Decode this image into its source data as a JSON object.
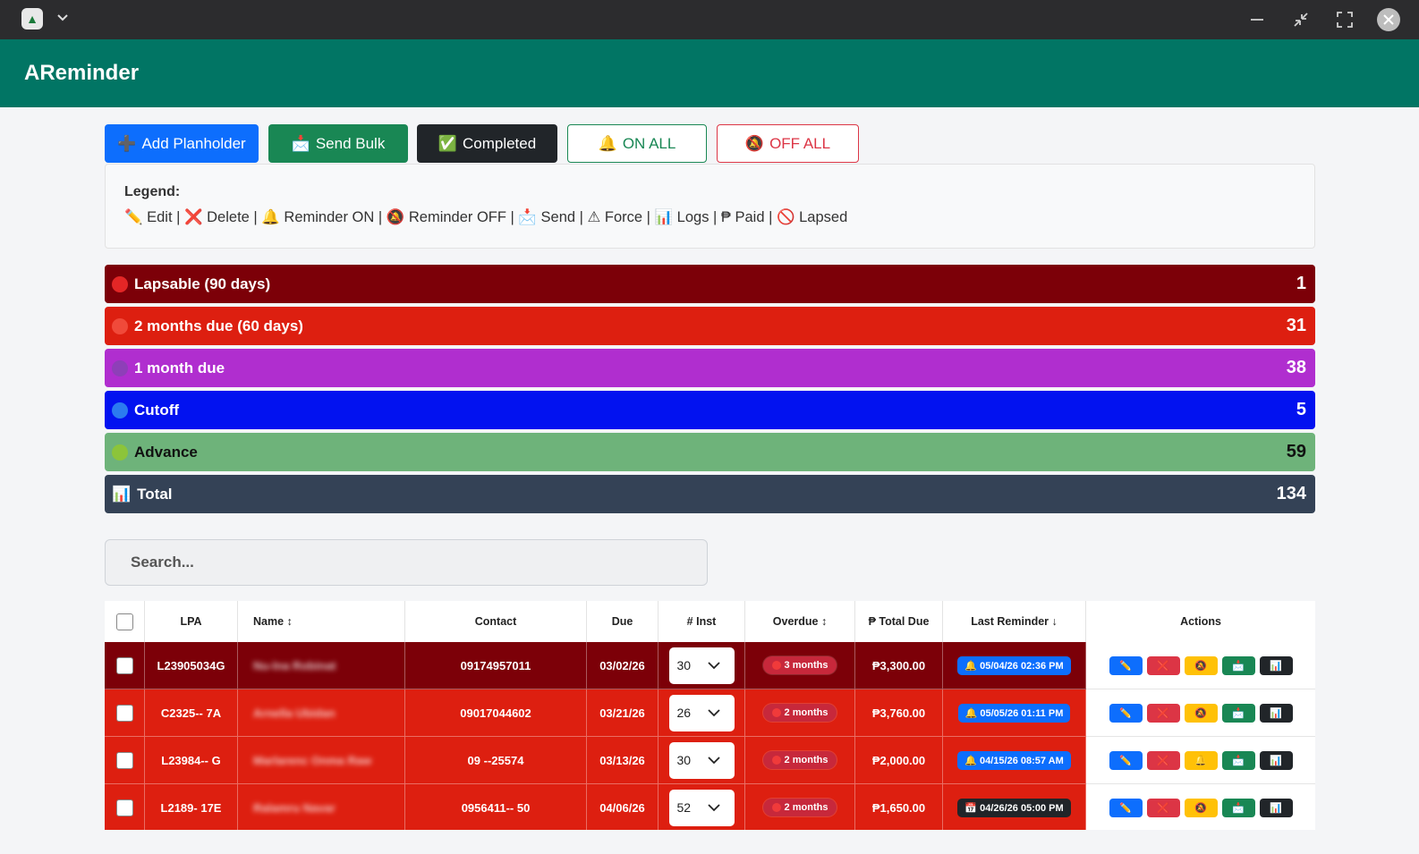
{
  "window": {
    "app_icon": "app-logo-icon"
  },
  "app": {
    "title": "AReminder"
  },
  "toolbar": {
    "add": {
      "icon": "➕",
      "label": "Add Planholder"
    },
    "bulk": {
      "icon": "📩",
      "label": "Send Bulk"
    },
    "completed": {
      "icon": "✅",
      "label": "Completed"
    },
    "on_all": {
      "icon": "🔔",
      "label": "ON ALL"
    },
    "off_all": {
      "icon": "🔕",
      "label": "OFF ALL"
    }
  },
  "legend": {
    "title": "Legend:",
    "text": "✏️ Edit | ❌ Delete | 🔔 Reminder ON | 🔕 Reminder OFF | 📩 Send | ⚠ Force | 📊 Logs | ₱ Paid | 🚫 Lapsed"
  },
  "summary": [
    {
      "label": "Lapsable (90 days)",
      "count": "1",
      "color": "#7c0008",
      "dot": "#e32626"
    },
    {
      "label": "2 months due (60 days)",
      "count": "31",
      "color": "#dd1f10",
      "dot": "#f04a3a"
    },
    {
      "label": "1 month due",
      "count": "38",
      "color": "#b02ecf",
      "dot": "#8e3fb8"
    },
    {
      "label": "Cutoff",
      "count": "5",
      "color": "#0212f0",
      "dot": "#2b7bf0"
    },
    {
      "label": "Advance",
      "count": "59",
      "color": "#6eb37a",
      "dot": "#8cc43a"
    },
    {
      "label": "Total",
      "count": "134",
      "color": "#344256",
      "icon": "📊"
    }
  ],
  "search": {
    "placeholder": "Search..."
  },
  "table": {
    "headers": {
      "lpa": "LPA",
      "name": "Name ↕",
      "contact": "Contact",
      "due": "Due",
      "inst": "# Inst",
      "overdue": "Overdue ↕",
      "total_due": "₱ Total Due",
      "last_reminder": "Last Reminder ↓",
      "actions": "Actions"
    },
    "rows": [
      {
        "lpa": "L23905034G",
        "name": "Nu-lna Robinat",
        "contact": "09174957011",
        "due": "03/02/26",
        "inst": "30",
        "overdue": "3 months",
        "total": "₱3,300.00",
        "reminder": "🔔 05/04/26 02:36 PM",
        "reminder_style": "blue",
        "reminder_action": "🔕",
        "color": "#7c0008"
      },
      {
        "lpa": "C2325-- 7A",
        "name": "Arnella Ubidan",
        "contact": "09017044602",
        "due": "03/21/26",
        "inst": "26",
        "overdue": "2 months",
        "total": "₱3,760.00",
        "reminder": "🔔 05/05/26 01:11 PM",
        "reminder_style": "blue",
        "reminder_action": "🔕",
        "color": "#dd1f10"
      },
      {
        "lpa": "L23984-- G",
        "name": "Marlarenc Onma Raw",
        "contact": "09 --25574",
        "due": "03/13/26",
        "inst": "30",
        "overdue": "2 months",
        "total": "₱2,000.00",
        "reminder": "🔔 04/15/26 08:57 AM",
        "reminder_style": "blue",
        "reminder_action": "🔔",
        "color": "#dd1f10"
      },
      {
        "lpa": "L2189- 17E",
        "name": "Ralamru Navar",
        "contact": "0956411-- 50",
        "due": "04/06/26",
        "inst": "52",
        "overdue": "2 months",
        "total": "₱1,650.00",
        "reminder": "📅 04/26/26 05:00 PM",
        "reminder_style": "dark",
        "reminder_action": "🔕",
        "color": "#dd1f10"
      }
    ],
    "action_icons": {
      "edit": "✏️",
      "delete": "❌",
      "send": "📩",
      "logs": "📊"
    }
  }
}
